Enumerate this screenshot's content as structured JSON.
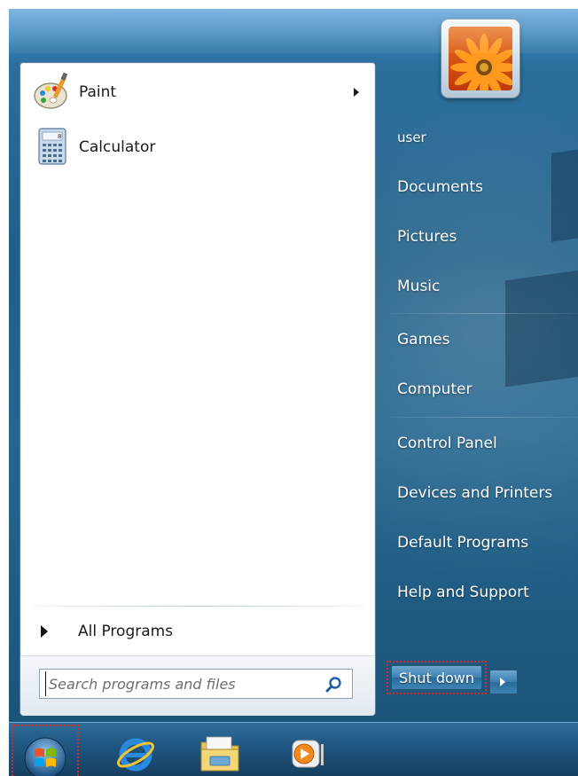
{
  "programs": [
    {
      "label": "Paint",
      "icon": "paint-icon",
      "has_submenu": true
    },
    {
      "label": "Calculator",
      "icon": "calculator-icon",
      "has_submenu": false
    }
  ],
  "all_programs": "All Programs",
  "search": {
    "placeholder": "Search programs and files"
  },
  "right_menu": {
    "user": "user",
    "documents": "Documents",
    "pictures": "Pictures",
    "music": "Music",
    "games": "Games",
    "computer": "Computer",
    "control_panel": "Control Panel",
    "devices_printers": "Devices and Printers",
    "default_programs": "Default Programs",
    "help_support": "Help and Support"
  },
  "shutdown": {
    "label": "Shut down"
  },
  "taskbar": {
    "items": [
      "start-orb",
      "internet-explorer-icon",
      "windows-explorer-icon",
      "media-player-icon"
    ]
  },
  "colors": {
    "highlight": "#d62a2a",
    "menu_blue": "#1f5e86"
  }
}
